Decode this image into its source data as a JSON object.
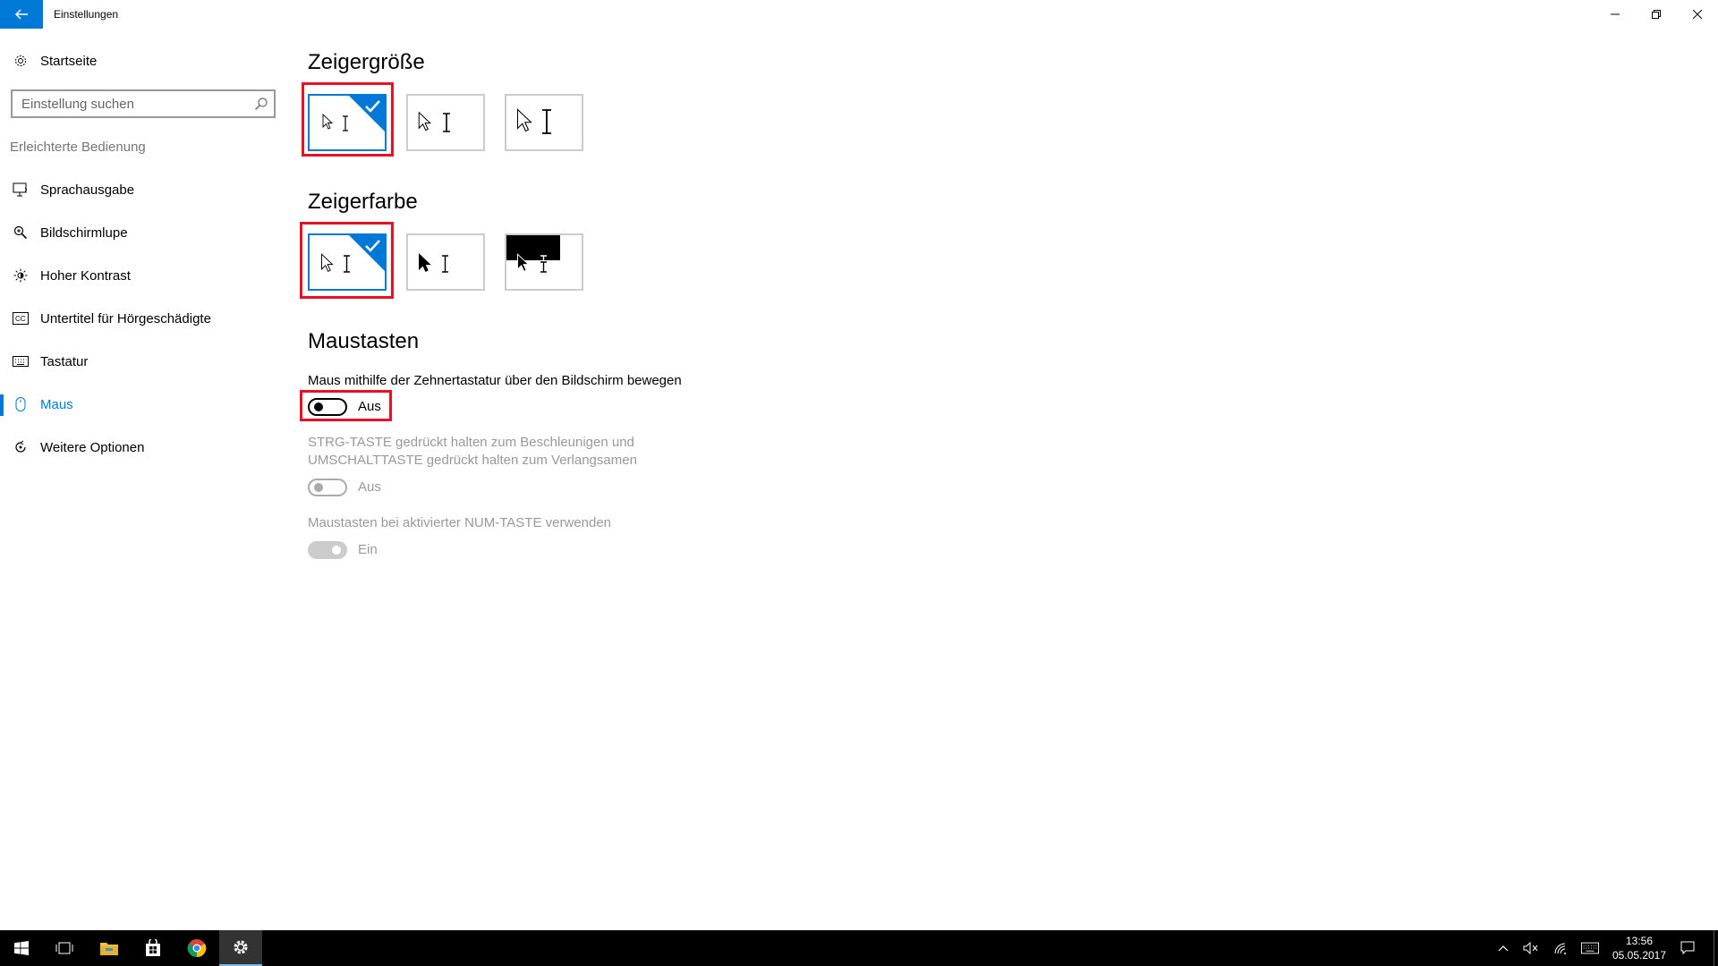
{
  "window": {
    "title": "Einstellungen"
  },
  "sidebar": {
    "home_label": "Startseite",
    "search_placeholder": "Einstellung suchen",
    "group_label": "Erleichterte Bedienung",
    "items": [
      {
        "label": "Sprachausgabe",
        "icon": "narrator-icon"
      },
      {
        "label": "Bildschirmlupe",
        "icon": "magnifier-icon"
      },
      {
        "label": "Hoher Kontrast",
        "icon": "contrast-icon"
      },
      {
        "label": "Untertitel für Hörgeschädigte",
        "icon": "closed-captions-icon"
      },
      {
        "label": "Tastatur",
        "icon": "keyboard-icon"
      },
      {
        "label": "Maus",
        "icon": "mouse-icon",
        "active": true
      },
      {
        "label": "Weitere Optionen",
        "icon": "other-options-icon"
      }
    ]
  },
  "pointer_size": {
    "title": "Zeigergröße",
    "options": [
      "small",
      "medium",
      "large"
    ],
    "selected_index": 0
  },
  "pointer_color": {
    "title": "Zeigerfarbe",
    "options": [
      "white",
      "black",
      "inverted"
    ],
    "selected_index": 0
  },
  "mouse_keys": {
    "title": "Maustasten",
    "setting1": {
      "description": "Maus mithilfe der Zehnertastatur über den Bildschirm bewegen",
      "state": "Aus",
      "enabled": true
    },
    "setting2": {
      "description_line1": "STRG-TASTE gedrückt halten zum Beschleunigen und",
      "description_line2": "UMSCHALTTASTE gedrückt halten zum Verlangsamen",
      "state": "Aus",
      "enabled": false
    },
    "setting3": {
      "description": "Maustasten bei aktivierter NUM-TASTE verwenden",
      "state": "Ein",
      "enabled": false
    }
  },
  "colors": {
    "accent": "#0078d7",
    "highlight": "#e81123",
    "taskbar": "#000000"
  },
  "taskbar": {
    "apps": [
      "start-icon",
      "task-view-icon",
      "file-explorer-icon",
      "store-icon",
      "chrome-icon",
      "settings-icon"
    ],
    "active_app": "settings-icon",
    "time": "13:56",
    "date": "05.05.2017"
  }
}
